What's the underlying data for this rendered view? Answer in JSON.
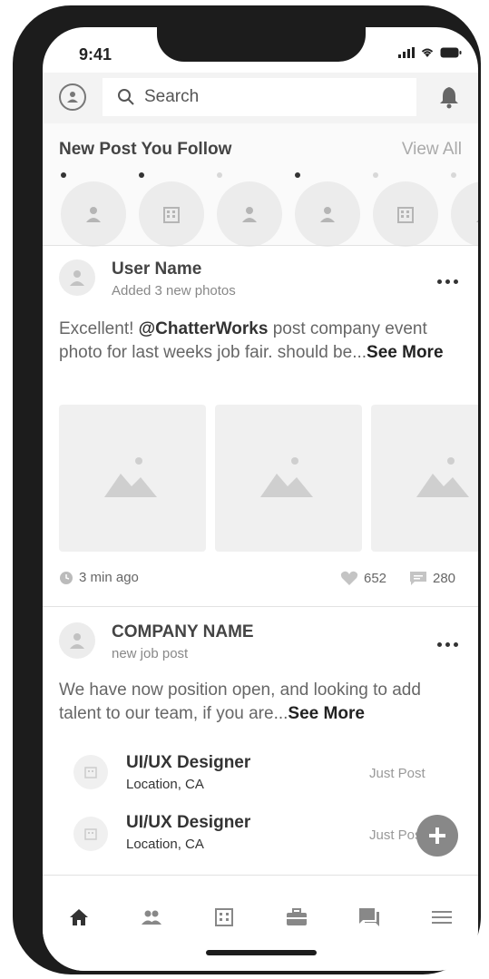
{
  "status_bar": {
    "time": "9:41"
  },
  "header": {
    "search_placeholder": "Search"
  },
  "follow_section": {
    "title": "New Post You Follow",
    "view_all": "View All",
    "items": [
      {
        "type": "person",
        "has_new": true
      },
      {
        "type": "company",
        "has_new": true
      },
      {
        "type": "person",
        "has_new": false
      },
      {
        "type": "person",
        "has_new": true
      },
      {
        "type": "company",
        "has_new": false
      },
      {
        "type": "person",
        "has_new": false
      }
    ]
  },
  "post1": {
    "author": "User Name",
    "subtitle": "Added 3 new photos",
    "text_before": "Excellent! ",
    "mention": "@ChatterWorks",
    "text_after": " post company event photo for last weeks job fair. should be...",
    "see_more": "See More",
    "photo_count": 3,
    "time": "3 min ago",
    "likes": "652",
    "comments": "280"
  },
  "post2": {
    "author": "COMPANY NAME",
    "subtitle": "new job post",
    "text": "We have now position open, and looking to add talent to our team, if you are...",
    "see_more": "See More",
    "jobs": [
      {
        "title": "UI/UX Designer",
        "location": "Location, CA",
        "time": "Just Post"
      },
      {
        "title": "UI/UX Designer",
        "location": "Location, CA",
        "time": "Just Post"
      }
    ]
  },
  "bottom_nav": [
    "home-icon",
    "people-icon",
    "company-icon",
    "jobs-icon",
    "messages-icon",
    "menu-icon"
  ],
  "colors": {
    "frame": "#1c1c1c",
    "placeholder": "#ececec",
    "fab": "#888888"
  }
}
